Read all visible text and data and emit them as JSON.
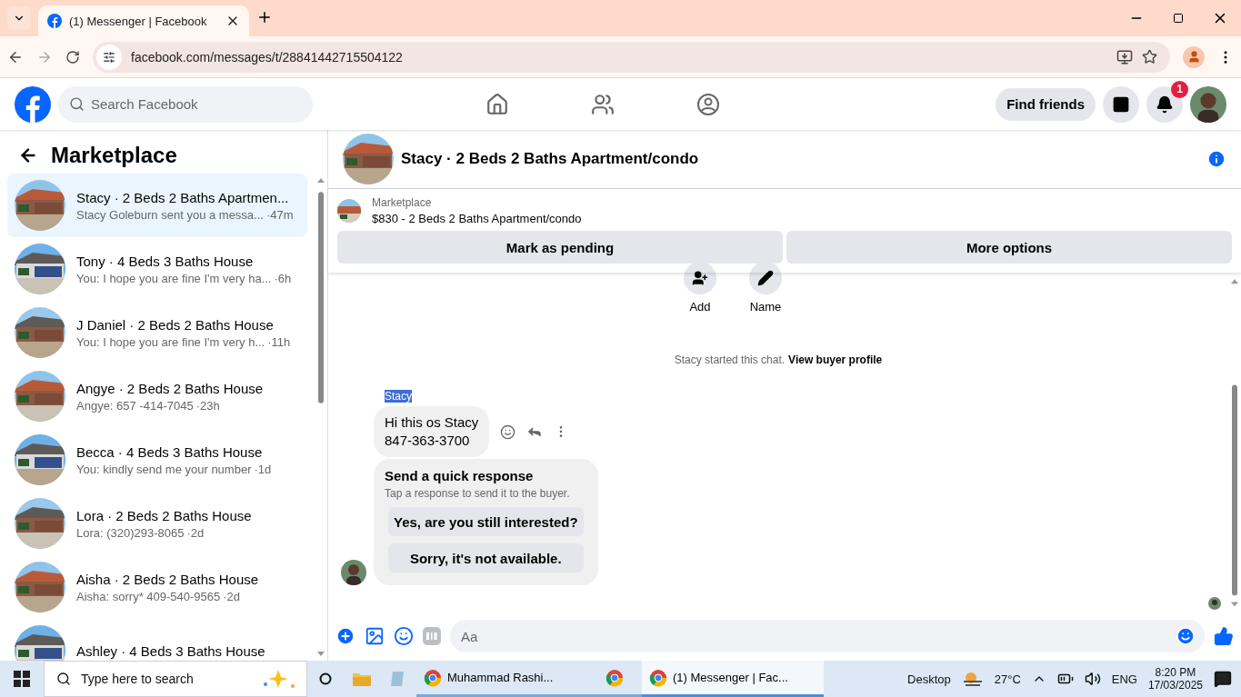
{
  "browser": {
    "tab_title": "(1) Messenger | Facebook",
    "url": "facebook.com/messages/t/28841442715504122"
  },
  "header": {
    "search_placeholder": "Search Facebook",
    "find_friends": "Find friends",
    "notification_count": "1"
  },
  "sidebar": {
    "title": "Marketplace",
    "conversations": [
      {
        "title": "Stacy · 2 Beds 2 Baths Apartmen...",
        "preview": "Stacy Goleburn sent you a messa...",
        "time": "·47m",
        "selected": true,
        "kind": "picture"
      },
      {
        "title": "Tony · 4 Beds 3 Baths House",
        "preview": "You: I hope you are fine I'm very ha...",
        "time": "·6h",
        "selected": false,
        "kind": "picture"
      },
      {
        "title": "J Daniel · 2 Beds 2 Baths House",
        "preview": "You: I hope you are fine I'm very h...",
        "time": "·11h",
        "selected": false,
        "kind": "picture"
      },
      {
        "title": "Angye · 2 Beds 2 Baths House",
        "preview": "Angye: 657 -414-7045",
        "time": "·23h",
        "selected": false,
        "kind": "picture"
      },
      {
        "title": "Becca · 4 Beds 3 Baths House",
        "preview": "You: kindly send me your number",
        "time": "·1d",
        "selected": false,
        "kind": "picture"
      },
      {
        "title": "Lora · 2 Beds 2 Baths House",
        "preview": "Lora: (320)293-8065",
        "time": "·2d",
        "selected": false,
        "kind": "picture"
      },
      {
        "title": "Aisha · 2 Beds 2 Baths House",
        "preview": "Aisha: sorry* 409-540-9565",
        "time": "·2d",
        "selected": false,
        "kind": "picture"
      },
      {
        "title": "Ashley · 4 Beds 3 Baths House",
        "selected": false,
        "kind": "picture"
      }
    ]
  },
  "chat": {
    "title": "Stacy · 2 Beds 2 Baths Apartment/condo",
    "listing": {
      "source": "Marketplace",
      "title": "$830 - 2 Beds 2 Baths Apartment/condo"
    },
    "listing_buttons": [
      "Mark as pending",
      "More options"
    ],
    "actions": [
      {
        "label": "Add",
        "kind": "add-person"
      },
      {
        "label": "Name",
        "kind": "pencil"
      }
    ],
    "notice": "Stacy started this chat.",
    "notice_link": "View buyer profile",
    "sender": "Stacy",
    "message_lines": [
      "Hi this os Stacy",
      "847-363-3700"
    ],
    "quick_response": {
      "title": "Send a quick response",
      "subtitle": "Tap a response to send it to the buyer.",
      "options": [
        "Yes, are you still interested?",
        "Sorry, it's not available."
      ]
    },
    "composer_placeholder": "Aa"
  },
  "taskbar": {
    "search_placeholder": "Type here to search",
    "apps": [
      {
        "label": "Muhammad Rashi...",
        "selected": false
      },
      {
        "selected": false
      },
      {
        "label": "(1) Messenger | Fac...",
        "selected": true
      }
    ],
    "desktop": "Desktop",
    "temperature": "27°C",
    "language": "ENG",
    "time": "8:20 PM",
    "date": "17/03/2025"
  }
}
